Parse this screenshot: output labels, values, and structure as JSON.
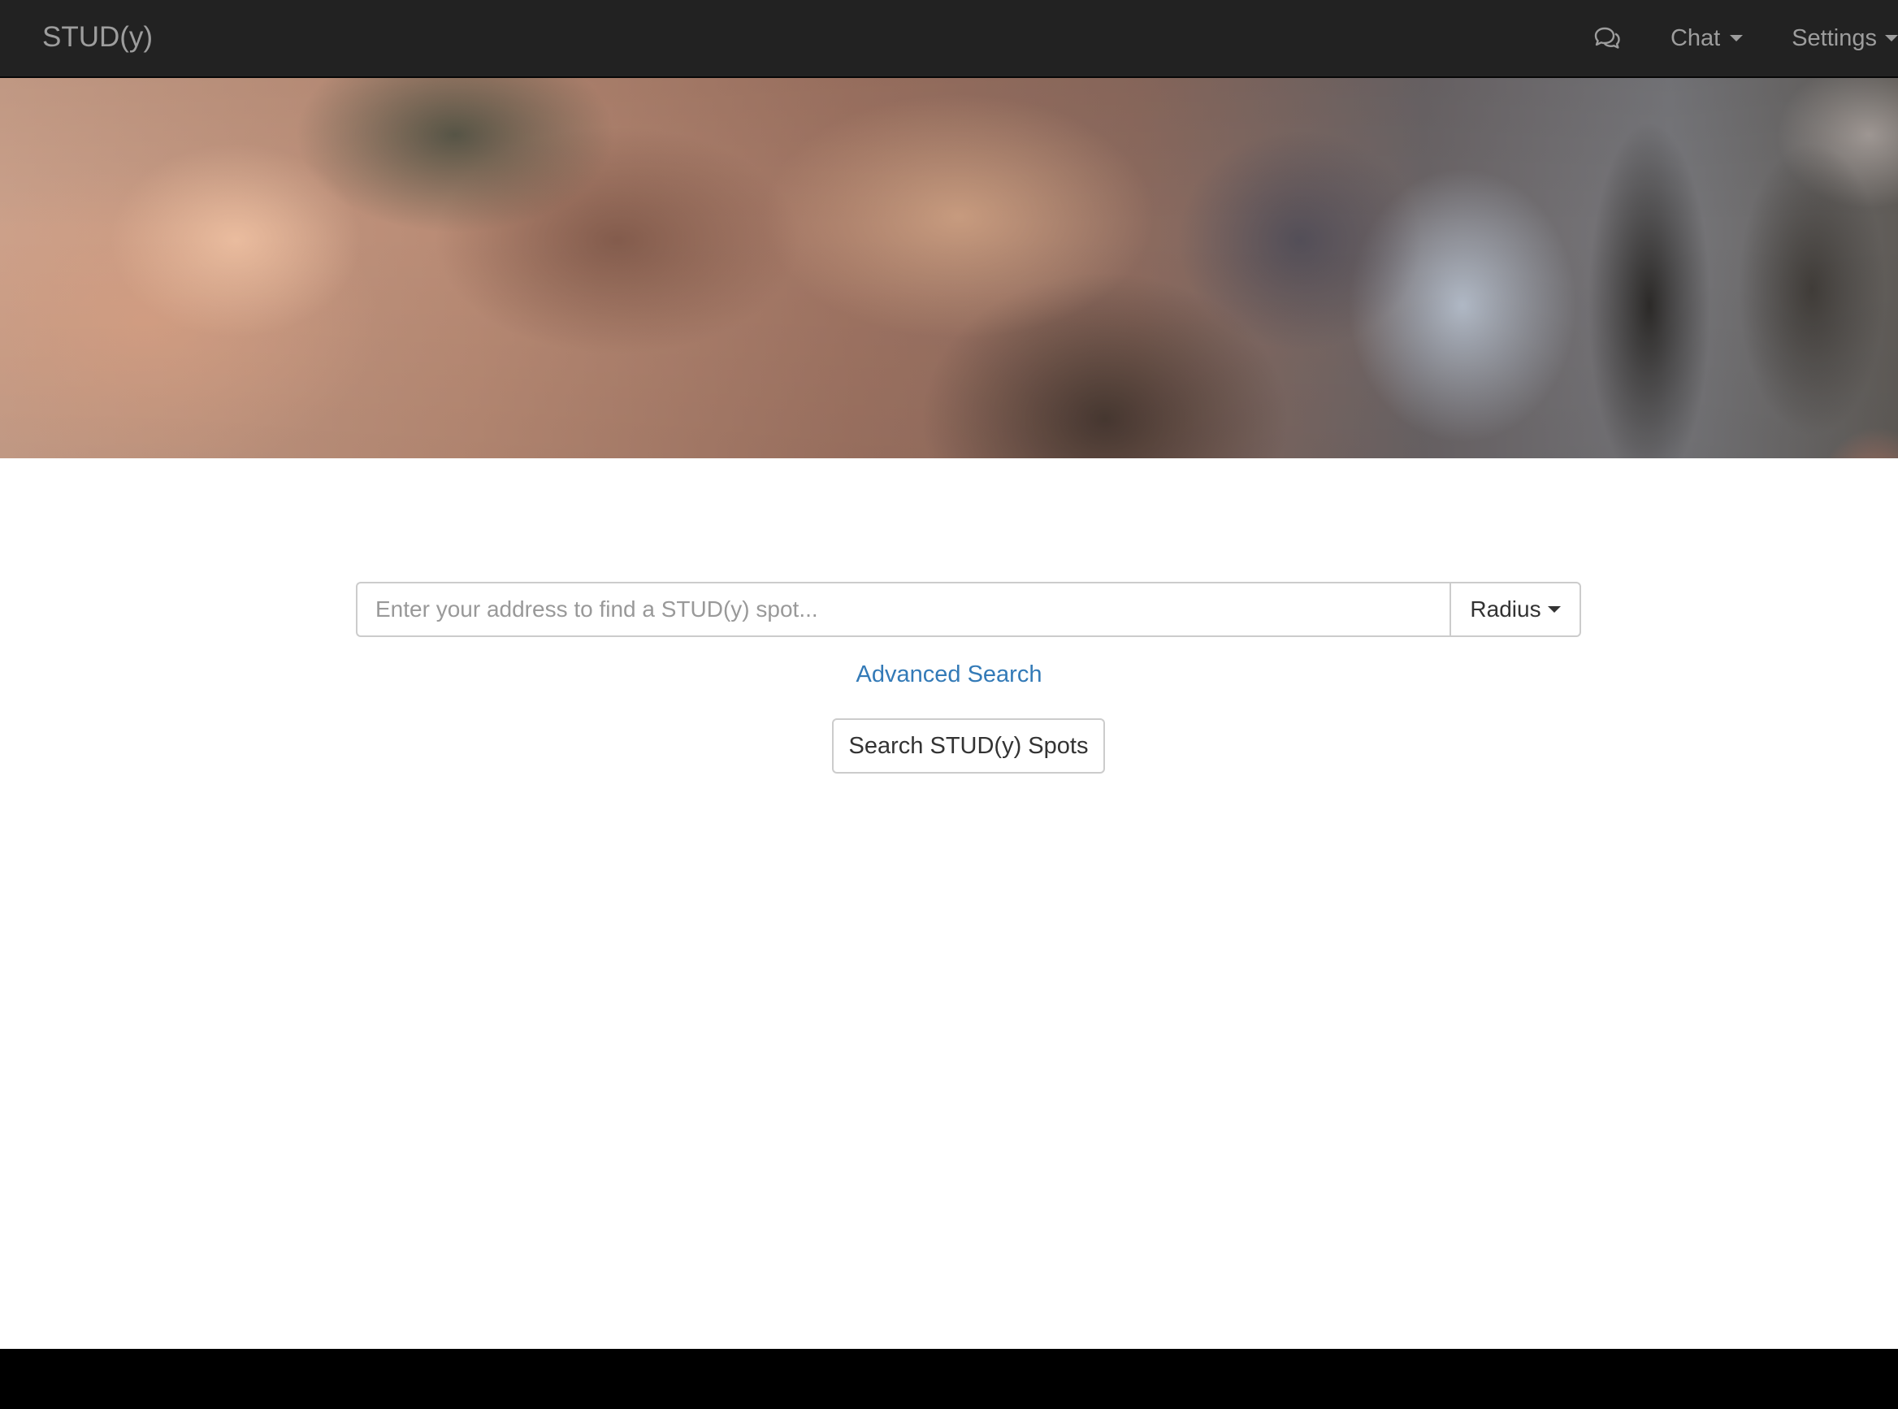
{
  "navbar": {
    "brand": "STUD(y)",
    "chat_icon": "chat-bubbles-icon",
    "chat_label": "Chat",
    "settings_label": "Settings"
  },
  "hero": {
    "image": "blurred-photo-banner"
  },
  "search": {
    "placeholder": "Enter your address to find a STUD(y) spot...",
    "value": "",
    "radius_label": "Radius",
    "advanced_link": "Advanced Search",
    "submit_label": "Search STUD(y) Spots"
  },
  "colors": {
    "navbar_bg": "#222222",
    "nav_text": "#9d9d9d",
    "link": "#337ab7",
    "footer_bg": "#000000"
  }
}
